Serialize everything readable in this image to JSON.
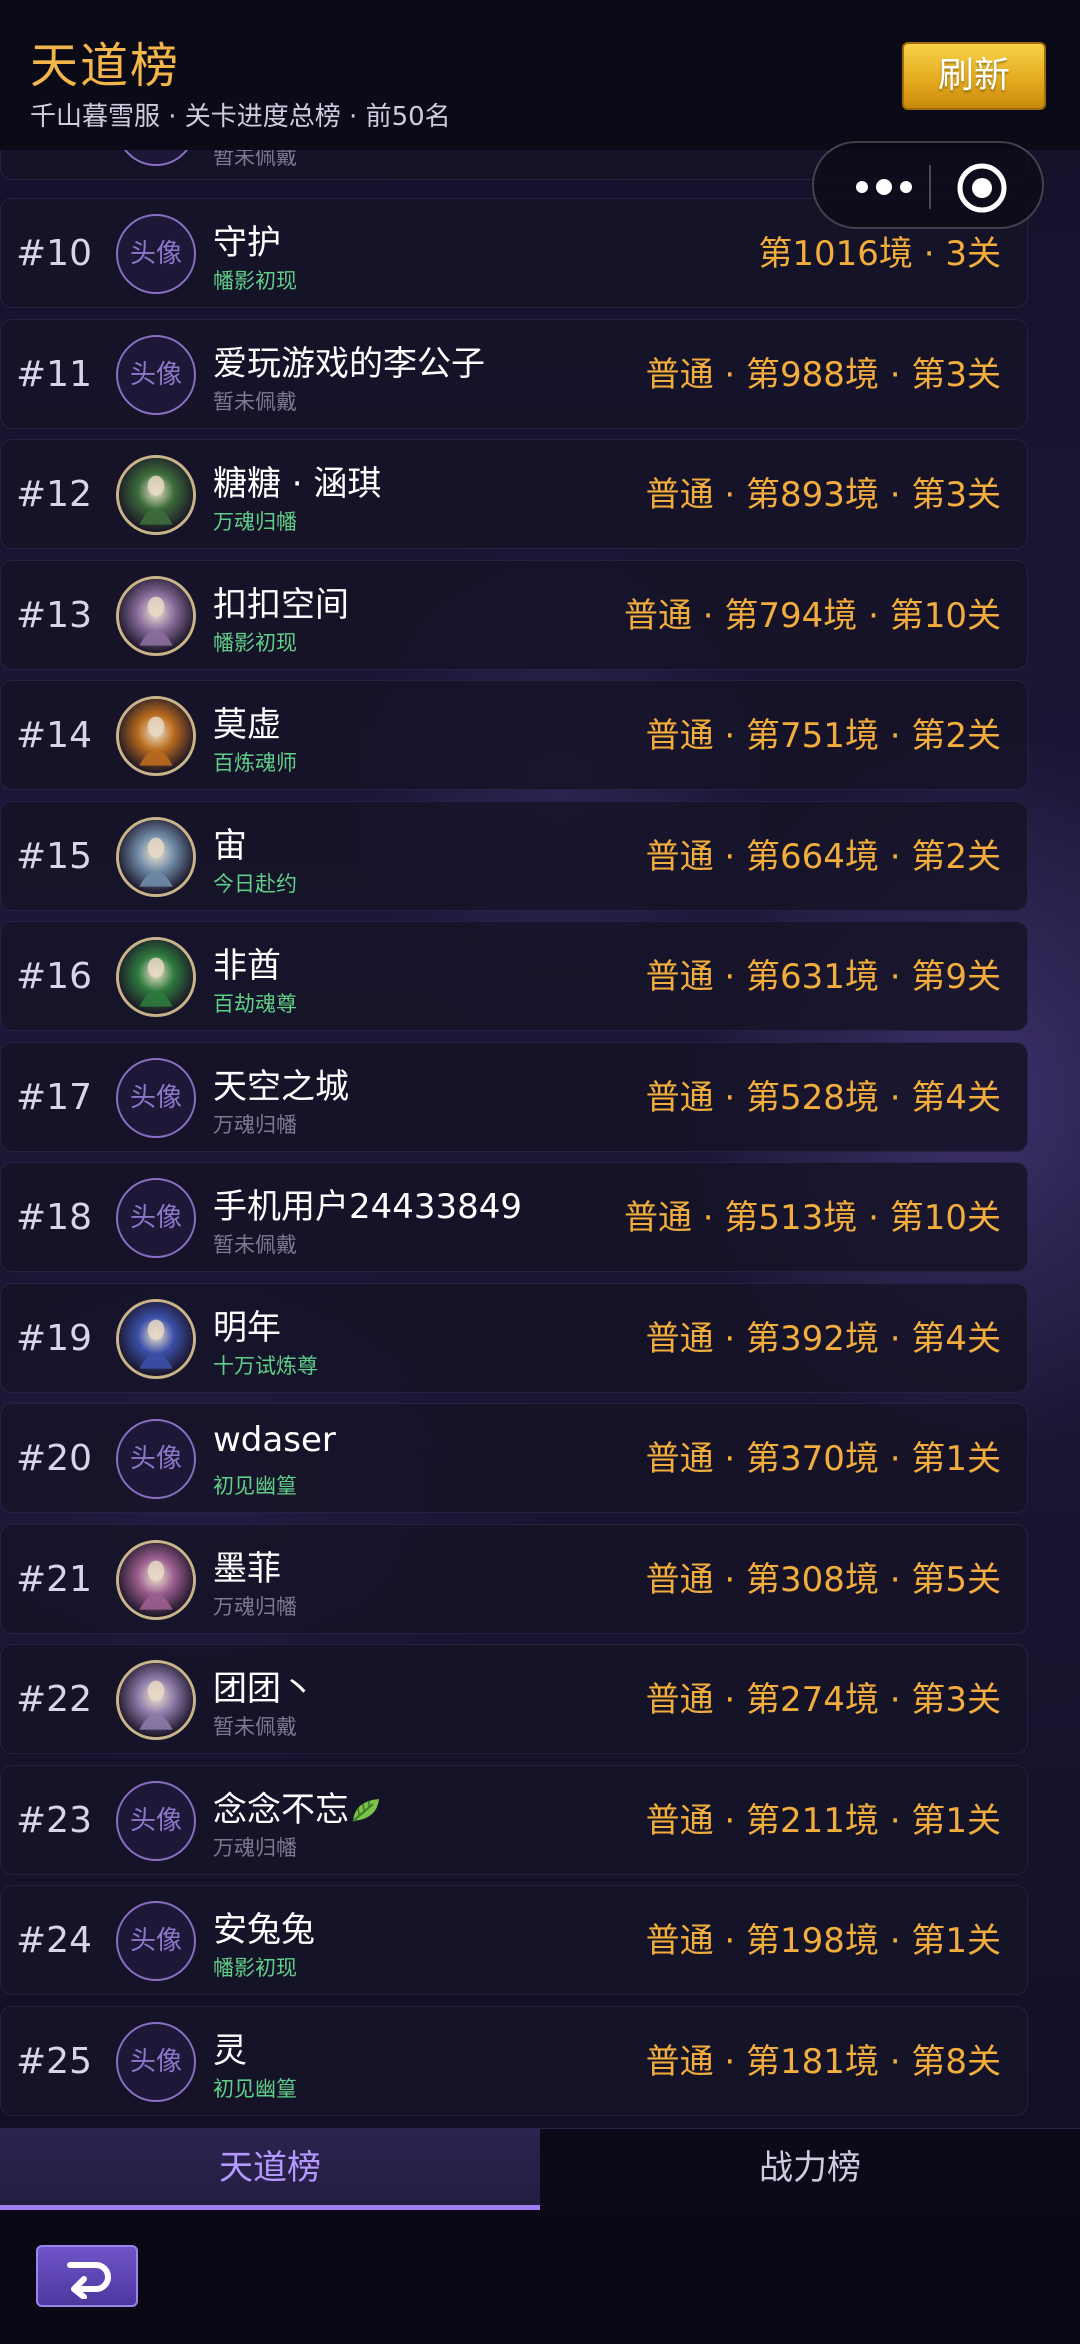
{
  "header": {
    "title": "天道榜",
    "subtitle": "千山暮雪服 · 关卡进度总榜 · 前50名",
    "refresh_label": "刷新"
  },
  "capsule": {
    "more_icon": "more-dots-icon",
    "close_icon": "target-icon"
  },
  "partial_top": {
    "tag": "暂未佩戴"
  },
  "ranking": [
    {
      "rank": "#10",
      "avatar": "头像",
      "name": "守护",
      "tag": "幡影初现",
      "tag_color": "green",
      "progress": "第1016境 · 3关",
      "has_image": false
    },
    {
      "rank": "#11",
      "avatar": "头像",
      "name": "爱玩游戏的李公子",
      "tag": "暂未佩戴",
      "tag_color": "gray",
      "progress": "普通 · 第988境 · 第3关",
      "has_image": false
    },
    {
      "rank": "#12",
      "avatar": "",
      "name": "糖糖 · 涵琪",
      "tag": "万魂归幡",
      "tag_color": "green",
      "progress": "普通 · 第893境 · 第3关",
      "has_image": true,
      "avatar_color": "#3c6b3a"
    },
    {
      "rank": "#13",
      "avatar": "",
      "name": "扣扣空间",
      "tag": "幡影初现",
      "tag_color": "green",
      "progress": "普通 · 第794境 · 第10关",
      "has_image": true,
      "avatar_color": "#8a6e9c"
    },
    {
      "rank": "#14",
      "avatar": "",
      "name": "莫虚",
      "tag": "百炼魂师",
      "tag_color": "green",
      "progress": "普通 · 第751境 · 第2关",
      "has_image": true,
      "avatar_color": "#b86a1e"
    },
    {
      "rank": "#15",
      "avatar": "",
      "name": "宙",
      "tag": "今日赴约",
      "tag_color": "green",
      "progress": "普通 · 第664境 · 第2关",
      "has_image": true,
      "avatar_color": "#6f8aa6"
    },
    {
      "rank": "#16",
      "avatar": "",
      "name": "非酋",
      "tag": "百劫魂尊",
      "tag_color": "green",
      "progress": "普通 · 第631境 · 第9关",
      "has_image": true,
      "avatar_color": "#2e7a3e"
    },
    {
      "rank": "#17",
      "avatar": "头像",
      "name": "天空之城",
      "tag": "万魂归幡",
      "tag_color": "gray",
      "progress": "普通 · 第528境 · 第4关",
      "has_image": false
    },
    {
      "rank": "#18",
      "avatar": "头像",
      "name": "手机用户24433849",
      "tag": "暂未佩戴",
      "tag_color": "gray",
      "progress": "普通 · 第513境 · 第10关",
      "has_image": false
    },
    {
      "rank": "#19",
      "avatar": "",
      "name": "明年",
      "tag": "十万试炼尊",
      "tag_color": "green",
      "progress": "普通 · 第392境 · 第4关",
      "has_image": true,
      "avatar_color": "#3b4fa8"
    },
    {
      "rank": "#20",
      "avatar": "头像",
      "name": "wdaser",
      "tag": "初见幽篁",
      "tag_color": "green",
      "progress": "普通 · 第370境 · 第1关",
      "has_image": false
    },
    {
      "rank": "#21",
      "avatar": "",
      "name": "墨菲",
      "tag": "万魂归幡",
      "tag_color": "gray",
      "progress": "普通 · 第308境 · 第5关",
      "has_image": true,
      "avatar_color": "#9a5e8e"
    },
    {
      "rank": "#22",
      "avatar": "",
      "name": "团团丶",
      "tag": "暂未佩戴",
      "tag_color": "gray",
      "progress": "普通 · 第274境 · 第3关",
      "has_image": true,
      "avatar_color": "#8c7aa8"
    },
    {
      "rank": "#23",
      "avatar": "头像",
      "name": "念念不忘",
      "tag": "万魂归幡",
      "tag_color": "gray",
      "progress": "普通 · 第211境 · 第1关",
      "has_image": false,
      "emoji": "leaf-icon"
    },
    {
      "rank": "#24",
      "avatar": "头像",
      "name": "安兔兔",
      "tag": "幡影初现",
      "tag_color": "green",
      "progress": "普通 · 第198境 · 第1关",
      "has_image": false
    },
    {
      "rank": "#25",
      "avatar": "头像",
      "name": "灵",
      "tag": "初见幽篁",
      "tag_color": "green",
      "progress": "普通 · 第181境 · 第8关",
      "has_image": false
    }
  ],
  "tabs": [
    {
      "label": "天道榜",
      "active": true
    },
    {
      "label": "战力榜",
      "active": false
    }
  ],
  "footer": {
    "back_icon": "back-arrow-icon"
  }
}
